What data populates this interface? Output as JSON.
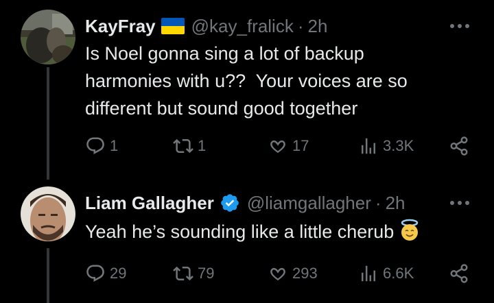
{
  "tweets": [
    {
      "name": "KayFray",
      "handle": "@kay_fralick",
      "dot": "·",
      "time": "2h",
      "text": "Is Noel gonna sing a lot of backup harmonies with u?? Your voices are so different but sound good together",
      "text_lines": [
        "Is Noel gonna sing a lot of backup",
        "harmonies with u??  Your voices are so",
        "different but sound good together"
      ],
      "badge": "ukraine-flag",
      "replies": "1",
      "reposts": "1",
      "likes": "17",
      "views": "3.3K"
    },
    {
      "name": "Liam Gallagher",
      "handle": "@liamgallagher",
      "dot": "·",
      "time": "2h",
      "text": "Yeah he’s sounding like a little cherub",
      "badge": "verified-badge",
      "emoji": "smiling-face-with-halo",
      "replies": "29",
      "reposts": "79",
      "likes": "293",
      "views": "6.6K"
    }
  ],
  "colors": {
    "background": "#000000",
    "text": "#e7e9ea",
    "muted": "#71767b",
    "verified": "#1d9bf0",
    "thread_line": "#333639"
  }
}
